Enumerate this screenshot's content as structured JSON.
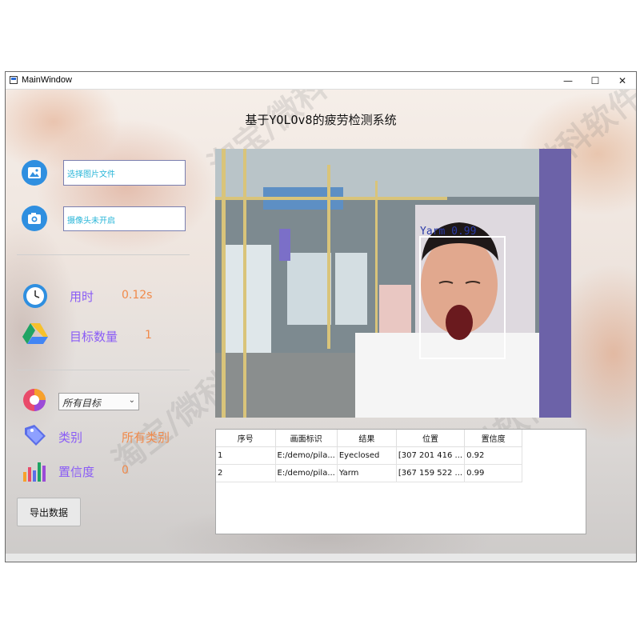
{
  "window": {
    "title": "MainWindow",
    "controls": {
      "minimize": "—",
      "maximize": "☐",
      "close": "✕"
    }
  },
  "app_title": "基于YOLOv8的疲劳检测系统",
  "left_panel": {
    "image_input": {
      "value": "选择图片文件",
      "icon": "image-icon"
    },
    "camera_input": {
      "value": "摄像头未开启",
      "icon": "camera-icon"
    },
    "time": {
      "label": "用时",
      "value": "0.12s",
      "icon": "clock-icon"
    },
    "target_count": {
      "label": "目标数量",
      "value": "1",
      "icon": "google-drive-icon"
    },
    "target_select": {
      "selected": "所有目标",
      "icon": "color-wheel-icon"
    },
    "category": {
      "label": "类别",
      "value": "所有类别",
      "icon": "tag-icon"
    },
    "confidence": {
      "label": "置信度",
      "value": "0",
      "icon": "bar-chart-icon"
    },
    "export_button": "导出数据"
  },
  "detection": {
    "label": "Yarm  0.99",
    "box_color": "#ffffff",
    "label_color": "#2a3aa8"
  },
  "results_table": {
    "headers": [
      "序号",
      "画面标识",
      "结果",
      "位置",
      "置信度"
    ],
    "rows": [
      [
        "1",
        "E:/demo/pila...",
        "Eyeclosed",
        "[307 201 416 ...",
        "0.92"
      ],
      [
        "2",
        "E:/demo/pila...",
        "Yarm",
        "[367 159 522 ...",
        "0.99"
      ]
    ]
  },
  "watermark": "淘宝/微科软件",
  "colors": {
    "label_purple": "#8a5cf6",
    "value_orange": "#f08a4b",
    "input_text_cyan": "#29b6d8"
  }
}
